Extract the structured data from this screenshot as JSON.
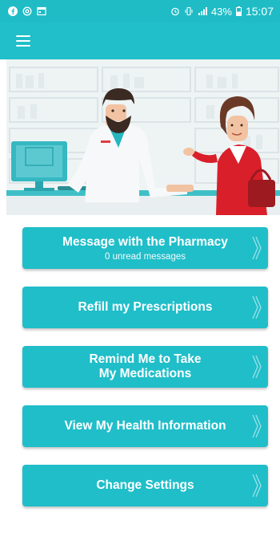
{
  "status_bar": {
    "battery": "43%",
    "time": "15:07"
  },
  "buttons": {
    "message_pharmacy": {
      "title": "Message with the Pharmacy",
      "subtitle": "0 unread messages"
    },
    "refill": {
      "title": "Refill my Prescriptions"
    },
    "remind": {
      "title_line1": "Remind Me to Take",
      "title_line2": "My Medications"
    },
    "health_info": {
      "title": "View My Health Information"
    },
    "settings": {
      "title": "Change Settings"
    }
  },
  "colors": {
    "brand": "#21bfc9",
    "status_bar": "#1fbcc6"
  },
  "icons": {
    "menu": "hamburger-menu-icon",
    "chevron": "double-chevron-right-icon"
  }
}
